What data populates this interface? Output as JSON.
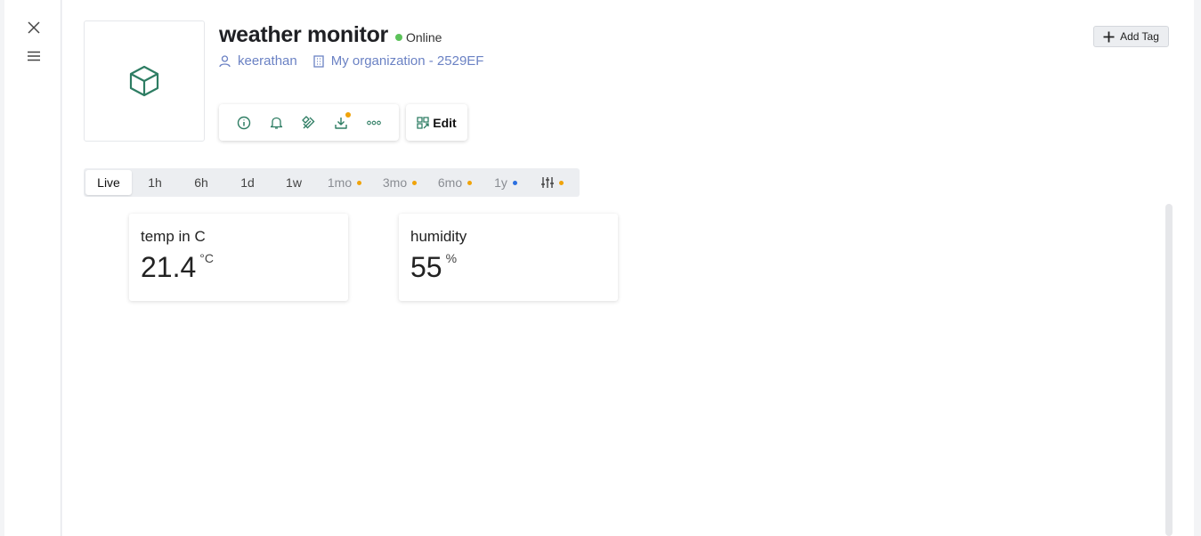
{
  "device": {
    "name": "weather monitor",
    "status": "Online",
    "owner": "keerathan",
    "organization": "My organization - 2529EF"
  },
  "actions": {
    "edit_label": "Edit",
    "add_tag_label": "Add Tag",
    "icons": [
      "info-icon",
      "bell-icon",
      "tools-icon",
      "download-icon",
      "more-icon"
    ]
  },
  "time_ranges": [
    {
      "label": "Live",
      "active": true
    },
    {
      "label": "1h"
    },
    {
      "label": "6h"
    },
    {
      "label": "1d"
    },
    {
      "label": "1w"
    },
    {
      "label": "1mo",
      "dot": "#f0a30a"
    },
    {
      "label": "3mo",
      "dot": "#f0a30a"
    },
    {
      "label": "6mo",
      "dot": "#f0a30a"
    },
    {
      "label": "1y",
      "dot": "#2b6fe0"
    }
  ],
  "custom_range_dot": "#f0a30a",
  "widgets": [
    {
      "title": "temp in C",
      "value": "21.4",
      "unit": "°C"
    },
    {
      "title": "humidity",
      "value": "55",
      "unit": "%"
    }
  ],
  "colors": {
    "accent_green": "#2e7d63",
    "online": "#5cc25a",
    "link": "#6b82c4"
  }
}
